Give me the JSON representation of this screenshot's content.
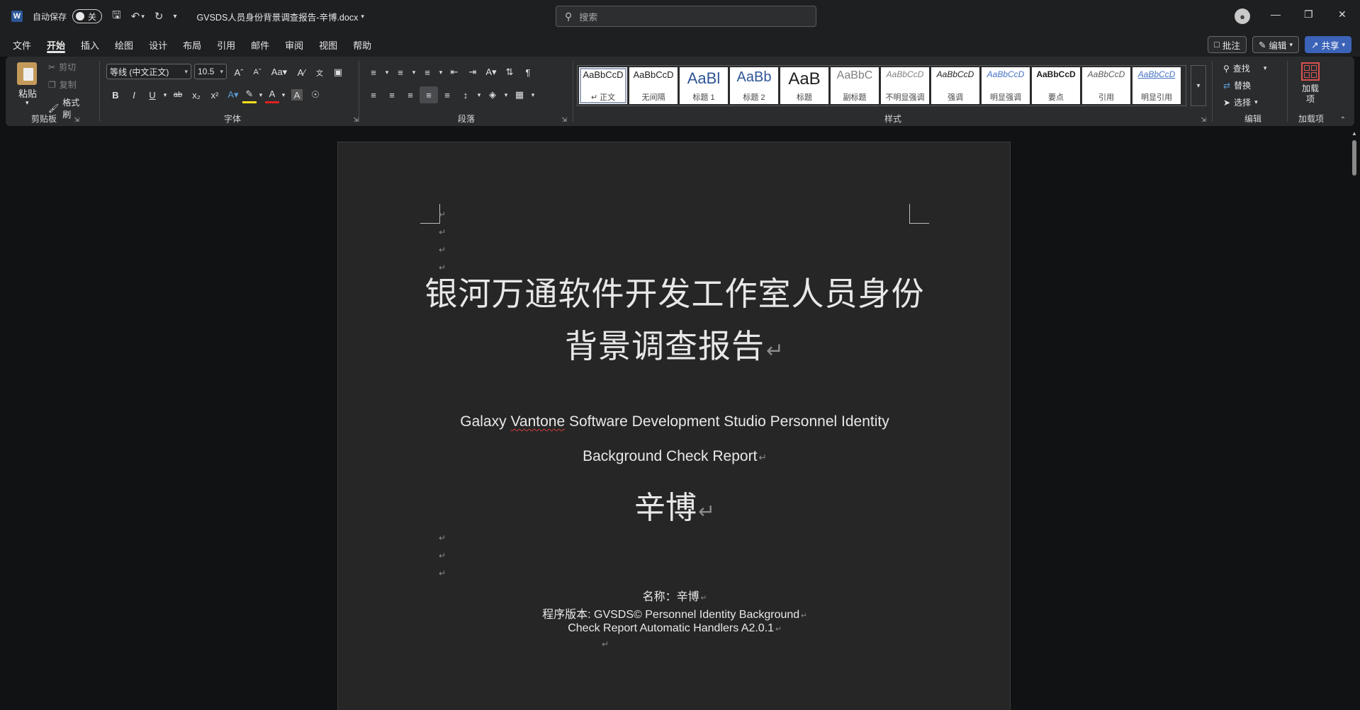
{
  "titlebar": {
    "app_letter": "W",
    "autosave_label": "自动保存",
    "autosave_state": "关",
    "doc_title": "GVSDS人员身份背景调查报告-辛博.docx",
    "search_placeholder": "搜索"
  },
  "menu": {
    "items": [
      "文件",
      "开始",
      "插入",
      "绘图",
      "设计",
      "布局",
      "引用",
      "邮件",
      "审阅",
      "视图",
      "帮助"
    ],
    "active": "开始",
    "comment_label": "批注",
    "edit_label": "编辑",
    "share_label": "共享"
  },
  "ribbon": {
    "clipboard": {
      "paste": "粘贴",
      "cut": "剪切",
      "copy": "复制",
      "format_painter": "格式刷",
      "label": "剪贴板"
    },
    "font": {
      "font_name": "等线 (中文正文)",
      "font_size": "10.5",
      "label": "字体"
    },
    "paragraph": {
      "label": "段落"
    },
    "styles": {
      "label": "样式",
      "items": [
        {
          "preview": "AaBbCcD",
          "name": "↵ 正文"
        },
        {
          "preview": "AaBbCcD",
          "name": "无间隔"
        },
        {
          "preview": "AaBl",
          "name": "标题 1"
        },
        {
          "preview": "AaBb",
          "name": "标题 2"
        },
        {
          "preview": "AaB",
          "name": "标题"
        },
        {
          "preview": "AaBbC",
          "name": "副标题"
        },
        {
          "preview": "AaBbCcD",
          "name": "不明显强调"
        },
        {
          "preview": "AaBbCcD",
          "name": "强调"
        },
        {
          "preview": "AaBbCcD",
          "name": "明显强调"
        },
        {
          "preview": "AaBbCcD",
          "name": "要点"
        },
        {
          "preview": "AaBbCcD",
          "name": "引用"
        },
        {
          "preview": "AaBbCcD",
          "name": "明显引用"
        }
      ]
    },
    "editing": {
      "find": "查找",
      "replace": "替换",
      "select": "选择",
      "label": "编辑"
    },
    "addins": {
      "button": "加载项",
      "label": "加载项"
    }
  },
  "document": {
    "title_cn_line1": "银河万通软件开发工作室人员身份",
    "title_cn_line2": "背景调查报告",
    "title_en_line1_pre": "Galaxy ",
    "title_en_misspelled": "Vantone",
    "title_en_line1_post": " Software Development Studio Personnel Identity",
    "title_en_line2": "Background Check Report",
    "author": "辛博",
    "name_label": "名称：辛博",
    "version_line1": "程序版本: GVSDS© Personnel Identity Background",
    "version_line2": "Check Report Automatic Handlers A2.0.1",
    "return_mark": "↵"
  }
}
